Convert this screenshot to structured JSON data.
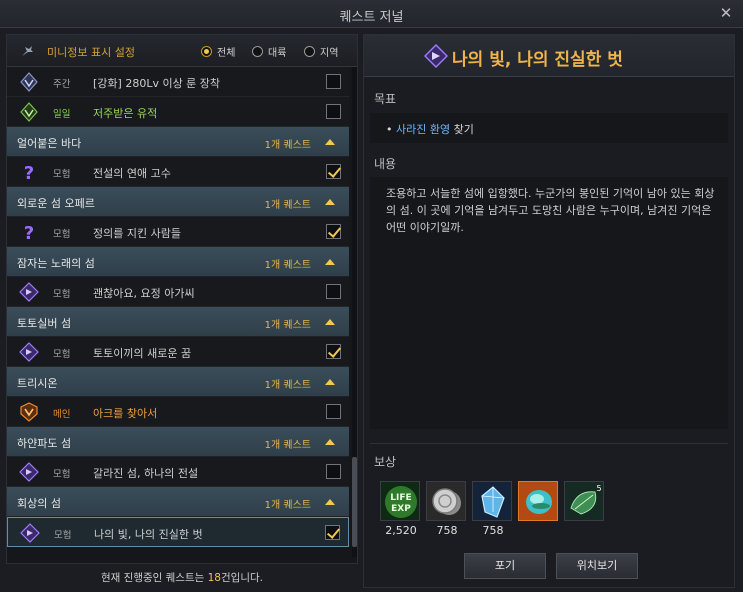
{
  "window": {
    "title": "퀘스트 저널"
  },
  "filter": {
    "label": "미니정보 표시 설정",
    "options": [
      {
        "label": "전체",
        "selected": true
      },
      {
        "label": "대륙",
        "selected": false
      },
      {
        "label": "지역",
        "selected": false
      }
    ]
  },
  "quests": {
    "row1": {
      "type": "주간",
      "name": "[강화] 280Lv 이상 룬 장착",
      "checked": false
    },
    "row2": {
      "type": "일일",
      "name": "저주받은 유적",
      "checked": false
    },
    "g1": {
      "name": "얼어붙은 바다",
      "count": "1개 퀘스트"
    },
    "row3": {
      "type": "모험",
      "name": "전설의 연애 고수",
      "checked": true
    },
    "g2": {
      "name": "외로운 섬 오페르",
      "count": "1개 퀘스트"
    },
    "row4": {
      "type": "모험",
      "name": "정의를 지킨 사람들",
      "checked": true
    },
    "g3": {
      "name": "잠자는 노래의 섬",
      "count": "1개 퀘스트"
    },
    "row5": {
      "type": "모험",
      "name": "괜찮아요, 요정 아가씨",
      "checked": false
    },
    "g4": {
      "name": "토토실버 섬",
      "count": "1개 퀘스트"
    },
    "row6": {
      "type": "모험",
      "name": "토토이끼의 새로운 꿈",
      "checked": true
    },
    "g5": {
      "name": "트리시온",
      "count": "1개 퀘스트"
    },
    "row7": {
      "type": "메인",
      "name": "아크를 찾아서",
      "checked": false
    },
    "g6": {
      "name": "하얀파도 섬",
      "count": "1개 퀘스트"
    },
    "row8": {
      "type": "모험",
      "name": "갈라진 섬, 하나의 전설",
      "checked": false
    },
    "g7": {
      "name": "회상의 섬",
      "count": "1개 퀘스트"
    },
    "row9": {
      "type": "모험",
      "name": "나의 빛, 나의 진실한 벗",
      "checked": true
    }
  },
  "status": {
    "prefix": "현재 진행중인 퀘스트는 ",
    "count": "18",
    "suffix": "건입니다."
  },
  "detail": {
    "title": "나의 빛, 나의 진실한 벗",
    "objective_header": "목표",
    "objective_bullet": "•",
    "objective_highlight": "사라진 환영",
    "objective_suffix": " 찾기",
    "content_header": "내용",
    "content": "조용하고 서늘한 섬에 입항했다. 누군가의 봉인된 기억이 남아 있는 회상의 섬. 이 곳에 기억을 남겨두고 도망친 사람은 누구이며, 남겨진 기억은 어떤 이야기일까.",
    "reward_header": "보상",
    "rewards": [
      {
        "icon": "life-exp-icon",
        "qty": "2,520"
      },
      {
        "icon": "silver-coin-icon",
        "qty": "758"
      },
      {
        "icon": "crystal-icon",
        "qty": "758"
      },
      {
        "icon": "orb-icon",
        "qty": ""
      },
      {
        "icon": "leaf-gem-icon",
        "qty": "",
        "badge": "5"
      }
    ],
    "abandon_label": "포기",
    "locate_label": "위치보기"
  },
  "colors": {
    "accent": "#f0b54a",
    "highlight": "#6fb8ff",
    "group_bar": "#364854"
  }
}
